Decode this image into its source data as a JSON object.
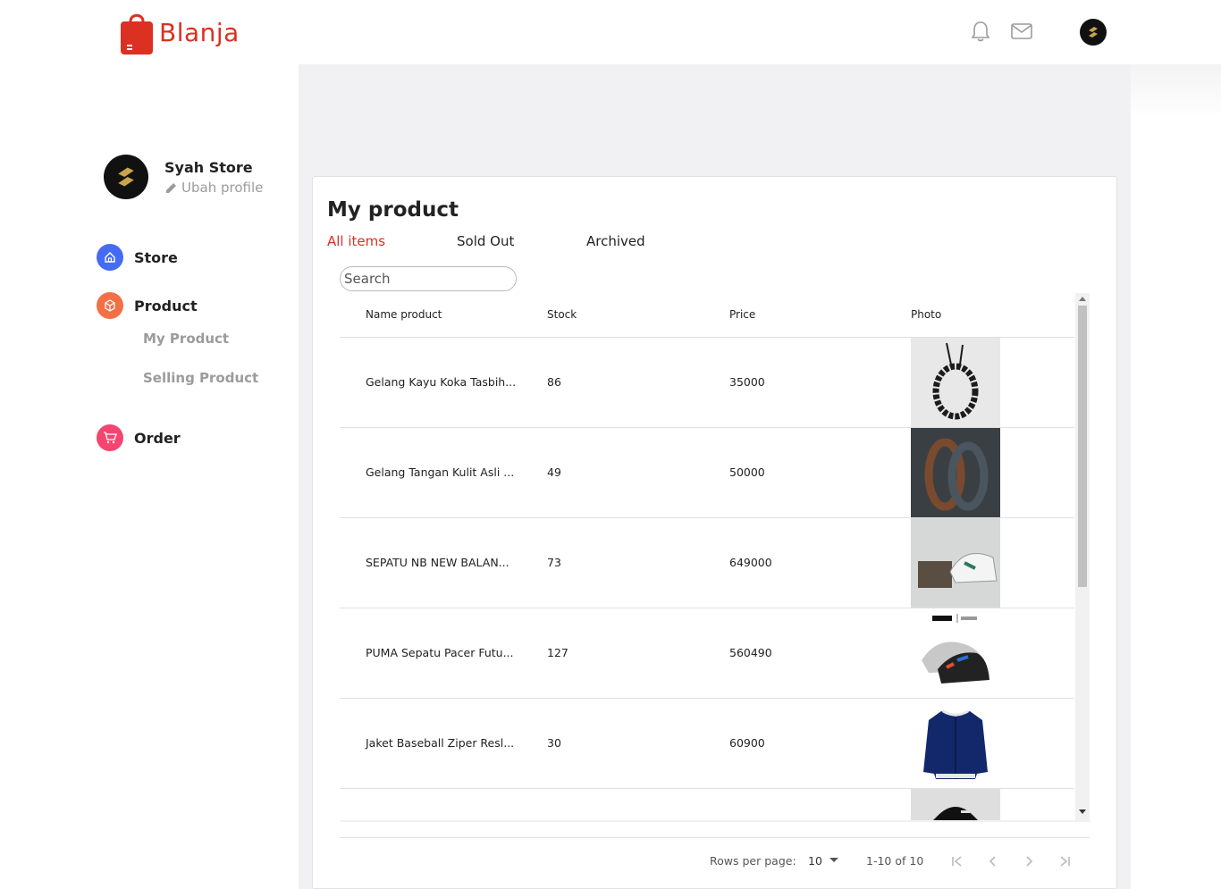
{
  "brand": {
    "name": "Blanja",
    "color": "#db3022"
  },
  "header": {
    "icons": [
      "bell-icon",
      "mail-icon"
    ]
  },
  "sidebar": {
    "store_name": "Syah Store",
    "edit_profile": "Ubah profile",
    "nav": [
      {
        "label": "Store",
        "icon": "home-icon",
        "color": "#456bf3"
      },
      {
        "label": "Product",
        "icon": "box-icon",
        "color": "#f36f45"
      },
      {
        "label": "Order",
        "icon": "cart-icon",
        "color": "#f3456f"
      }
    ],
    "sub": [
      "My Product",
      "Selling Product"
    ]
  },
  "main": {
    "title": "My product",
    "tabs": [
      "All items",
      "Sold Out",
      "Archived"
    ],
    "active_tab": "All items",
    "search_placeholder": "Search",
    "columns": [
      "Name product",
      "Stock",
      "Price",
      "Photo"
    ],
    "rows": [
      {
        "name": "Gelang Kayu Koka Tasbih...",
        "stock": "86",
        "price": "35000",
        "photo": "bracelet-photo"
      },
      {
        "name": "Gelang Tangan Kulit Asli ...",
        "stock": "49",
        "price": "50000",
        "photo": "leather-bracelet-photo"
      },
      {
        "name": "SEPATU NB NEW BALAN...",
        "stock": "73",
        "price": "649000",
        "photo": "sneaker-box-photo"
      },
      {
        "name": "PUMA Sepatu Pacer Futu...",
        "stock": "127",
        "price": "560490",
        "photo": "puma-shoe-photo"
      },
      {
        "name": "Jaket Baseball Ziper Resl...",
        "stock": "30",
        "price": "60900",
        "photo": "jacket-photo"
      }
    ],
    "pagination": {
      "rows_per_page_label": "Rows per page:",
      "rows_per_page": "10",
      "range": "1-10 of 10"
    }
  }
}
